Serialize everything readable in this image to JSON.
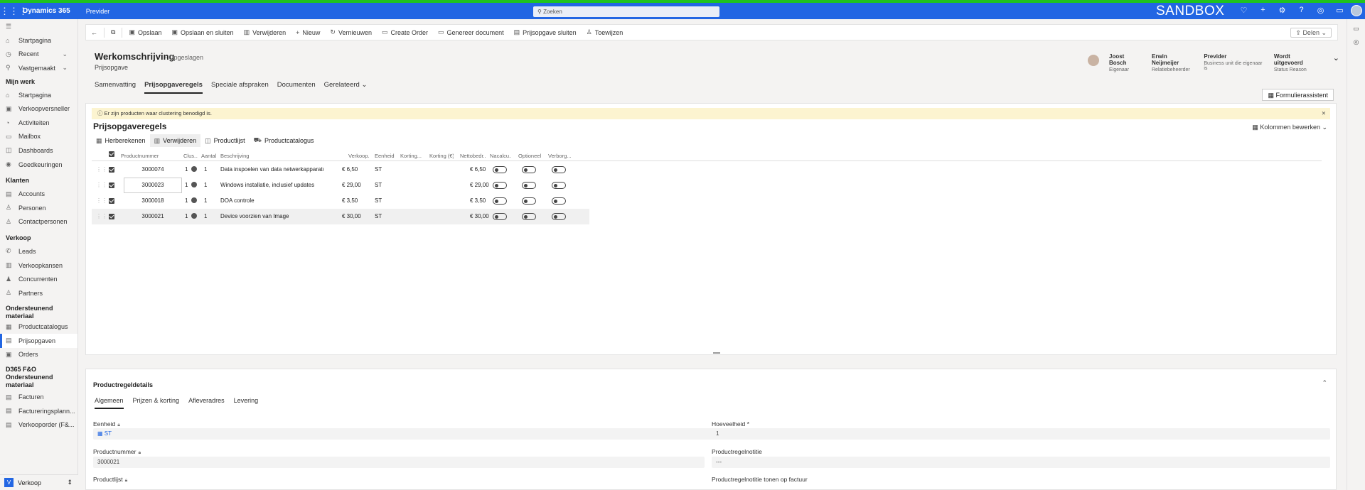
{
  "topbar": {
    "app_name": "Dynamics 365",
    "environment": "Previder",
    "search_placeholder": "Zoeken",
    "sandbox_label": "SANDBOX"
  },
  "sidebar": {
    "top_items": [
      {
        "label": "Startpagina",
        "icon": "home-icon"
      },
      {
        "label": "Recent",
        "icon": "clock-icon"
      },
      {
        "label": "Vastgemaakt",
        "icon": "pin-icon"
      }
    ],
    "sections": [
      {
        "title": "Mijn werk",
        "items": [
          {
            "label": "Startpagina",
            "icon": "home-icon"
          },
          {
            "label": "Verkoopversneller",
            "icon": "rocket-icon"
          },
          {
            "label": "Activiteiten",
            "icon": "activity-icon"
          },
          {
            "label": "Mailbox",
            "icon": "mail-icon"
          },
          {
            "label": "Dashboards",
            "icon": "dashboard-icon"
          },
          {
            "label": "Goedkeuringen",
            "icon": "approval-icon"
          }
        ]
      },
      {
        "title": "Klanten",
        "items": [
          {
            "label": "Accounts",
            "icon": "building-icon"
          },
          {
            "label": "Personen",
            "icon": "person-icon"
          },
          {
            "label": "Contactpersonen",
            "icon": "contacts-icon"
          }
        ]
      },
      {
        "title": "Verkoop",
        "items": [
          {
            "label": "Leads",
            "icon": "phone-icon"
          },
          {
            "label": "Verkoopkansen",
            "icon": "opportunity-icon"
          },
          {
            "label": "Concurrenten",
            "icon": "competitor-icon"
          },
          {
            "label": "Partners",
            "icon": "partner-icon"
          }
        ]
      },
      {
        "title": "Ondersteunend materiaal",
        "items": [
          {
            "label": "Productcatalogus",
            "icon": "catalog-icon"
          },
          {
            "label": "Prijsopgaven",
            "icon": "quote-icon",
            "active": true
          },
          {
            "label": "Orders",
            "icon": "order-icon"
          }
        ]
      },
      {
        "title": "D365 F&O Ondersteunend materiaal",
        "items": [
          {
            "label": "Facturen",
            "icon": "invoice-icon"
          },
          {
            "label": "Factureringsplann...",
            "icon": "billing-icon"
          },
          {
            "label": "Verkooporder (F&...",
            "icon": "salesorder-icon"
          }
        ]
      }
    ],
    "footer": {
      "badge": "V",
      "label": "Verkoop"
    }
  },
  "commandbar": {
    "items": [
      {
        "label": "Opslaan",
        "icon": "save-icon"
      },
      {
        "label": "Opslaan en sluiten",
        "icon": "save-close-icon"
      },
      {
        "label": "Verwijderen",
        "icon": "delete-icon"
      },
      {
        "label": "Nieuw",
        "icon": "plus-icon"
      },
      {
        "label": "Vernieuwen",
        "icon": "refresh-icon"
      },
      {
        "label": "Create Order",
        "icon": "order-icon"
      },
      {
        "label": "Genereer document",
        "icon": "document-icon"
      },
      {
        "label": "Prijsopgave sluiten",
        "icon": "close-quote-icon"
      },
      {
        "label": "Toewijzen",
        "icon": "assign-icon"
      }
    ],
    "share_label": "Delen"
  },
  "record": {
    "title": "Werkomschrijving",
    "save_state": "- Opgeslagen",
    "entity": "Prijsopgave",
    "tabs": [
      "Samenvatting",
      "Prijsopgaveregels",
      "Speciale afspraken",
      "Documenten",
      "Gerelateerd"
    ],
    "active_tab": "Prijsopgaveregels",
    "header_fields": [
      {
        "value": "Joost Bosch",
        "label": "Eigenaar"
      },
      {
        "value": "Erwin Neijmeijer",
        "label": "Relatiebeheerder"
      },
      {
        "value": "Previder",
        "label": "Business unit die eigenaar is"
      },
      {
        "value": "Wordt uitgevoerd",
        "label": "Status Reason"
      }
    ],
    "form_assistant": "Formulierassistent"
  },
  "grid": {
    "notice": "Er zijn producten waar clustering benodigd is.",
    "title": "Prijsopgaveregels",
    "edit_columns": "Kolommen bewerken",
    "commands": [
      {
        "label": "Herberekenen",
        "icon": "calculator-icon"
      },
      {
        "label": "Verwijderen",
        "icon": "delete-icon"
      },
      {
        "label": "Productlijst",
        "icon": "productlist-icon"
      },
      {
        "label": "Productcatalogus",
        "icon": "cart-icon"
      }
    ],
    "columns": [
      "Productnummer",
      "Clus...",
      "Aantal",
      "Beschrijving",
      "Verkoop...",
      "Eenheid",
      "Korting...",
      "Korting (€)",
      "Nettobedr...",
      "Nacalcu...",
      "Optioneel",
      "Verborg..."
    ],
    "rows": [
      {
        "productnummer": "3000074",
        "clus": "1",
        "aantal": "1",
        "beschrijving": "Data inspoelen van data netwerkapparatu",
        "verkoop": "€ 6,50",
        "eenheid": "ST",
        "korting_pct": "",
        "korting_eur": "",
        "netto": "€ 6,50"
      },
      {
        "productnummer": "3000023",
        "clus": "1",
        "aantal": "1",
        "beschrijving": "Windows installatie, inclusief updates",
        "verkoop": "€ 29,00",
        "eenheid": "ST",
        "korting_pct": "",
        "korting_eur": "",
        "netto": "€ 29,00"
      },
      {
        "productnummer": "3000018",
        "clus": "1",
        "aantal": "1",
        "beschrijving": "DOA controle",
        "verkoop": "€ 3,50",
        "eenheid": "ST",
        "korting_pct": "",
        "korting_eur": "",
        "netto": "€ 3,50"
      },
      {
        "productnummer": "3000021",
        "clus": "1",
        "aantal": "1",
        "beschrijving": "Device voorzien van Image",
        "verkoop": "€ 30,00",
        "eenheid": "ST",
        "korting_pct": "",
        "korting_eur": "",
        "netto": "€ 30,00"
      }
    ]
  },
  "details": {
    "title": "Productregeldetails",
    "tabs": [
      "Algemeen",
      "Prijzen & korting",
      "Afleveradres",
      "Levering"
    ],
    "fields": {
      "eenheid_label": "Eenheid",
      "eenheid_value": "ST",
      "hoeveelheid_label": "Hoeveelheid *",
      "hoeveelheid_value": "1",
      "productnummer_label": "Productnummer",
      "productnummer_value": "3000021",
      "notitie_label": "Productregelnotitie",
      "notitie_value": "---",
      "productlijst_label": "Productlijst",
      "notitie_factuur_label": "Productregelnotitie tonen op factuur"
    }
  }
}
